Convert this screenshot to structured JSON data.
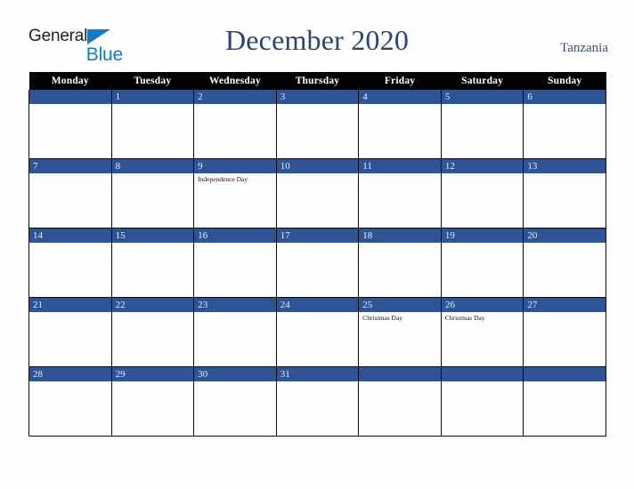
{
  "brand": {
    "name_part1": "General",
    "name_part2": "Blue",
    "triangle_icon": "triangle-icon"
  },
  "header": {
    "title": "December 2020",
    "country": "Tanzania"
  },
  "colors": {
    "header_bar": "#020202",
    "day_number_bar": "#2f5496",
    "title_text": "#2e4470",
    "country_text": "#3a4f78",
    "brand_blue": "#1779c4",
    "page_background": "#fdfdfd",
    "grid_line": "#0b0b0b"
  },
  "calendar": {
    "month": "December",
    "year": "2020",
    "weekday_headers": [
      "Monday",
      "Tuesday",
      "Wednesday",
      "Thursday",
      "Friday",
      "Saturday",
      "Sunday"
    ],
    "weeks": [
      [
        {
          "day": "",
          "events": []
        },
        {
          "day": "1",
          "events": []
        },
        {
          "day": "2",
          "events": []
        },
        {
          "day": "3",
          "events": []
        },
        {
          "day": "4",
          "events": []
        },
        {
          "day": "5",
          "events": []
        },
        {
          "day": "6",
          "events": []
        }
      ],
      [
        {
          "day": "7",
          "events": []
        },
        {
          "day": "8",
          "events": []
        },
        {
          "day": "9",
          "events": [
            "Independence Day"
          ]
        },
        {
          "day": "10",
          "events": []
        },
        {
          "day": "11",
          "events": []
        },
        {
          "day": "12",
          "events": []
        },
        {
          "day": "13",
          "events": []
        }
      ],
      [
        {
          "day": "14",
          "events": []
        },
        {
          "day": "15",
          "events": []
        },
        {
          "day": "16",
          "events": []
        },
        {
          "day": "17",
          "events": []
        },
        {
          "day": "18",
          "events": []
        },
        {
          "day": "19",
          "events": []
        },
        {
          "day": "20",
          "events": []
        }
      ],
      [
        {
          "day": "21",
          "events": []
        },
        {
          "day": "22",
          "events": []
        },
        {
          "day": "23",
          "events": []
        },
        {
          "day": "24",
          "events": []
        },
        {
          "day": "25",
          "events": [
            "Christmas Day"
          ]
        },
        {
          "day": "26",
          "events": [
            "Christmas Day"
          ]
        },
        {
          "day": "27",
          "events": []
        }
      ],
      [
        {
          "day": "28",
          "events": []
        },
        {
          "day": "29",
          "events": []
        },
        {
          "day": "30",
          "events": []
        },
        {
          "day": "31",
          "events": []
        },
        {
          "day": "",
          "events": []
        },
        {
          "day": "",
          "events": []
        },
        {
          "day": "",
          "events": []
        }
      ]
    ]
  }
}
